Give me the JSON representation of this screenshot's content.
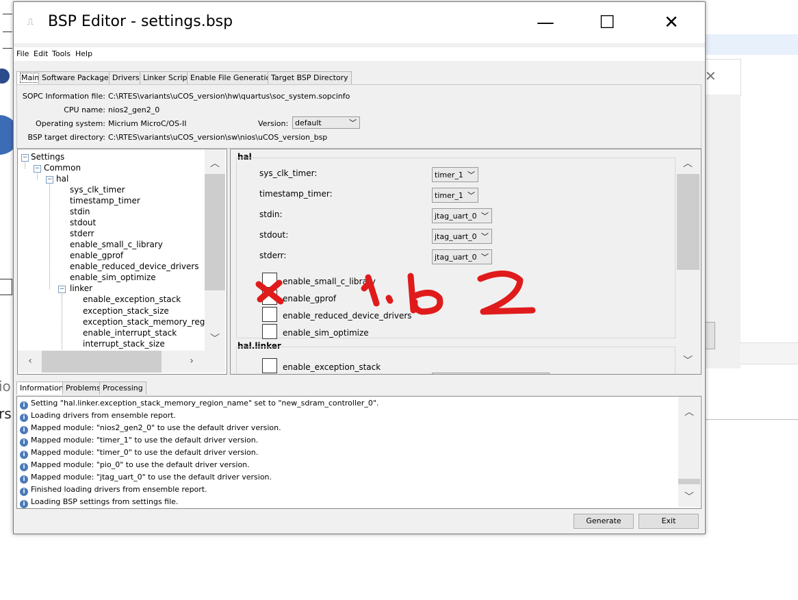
{
  "window": {
    "title": "BSP Editor - settings.bsp",
    "minimize": "—",
    "maximize": "☐",
    "close": "✕"
  },
  "menu": [
    "File",
    "Edit",
    "Tools",
    "Help"
  ],
  "tabs": [
    "Main",
    "Software Packages",
    "Drivers",
    "Linker Script",
    "Enable File Generation",
    "Target BSP Directory"
  ],
  "main": {
    "sopc_label": "SOPC Information file:",
    "sopc_value": "C:\\RTES\\variants\\uCOS_version\\hw\\quartus\\soc_system.sopcinfo",
    "cpu_label": "CPU name:",
    "cpu_value": "nios2_gen2_0",
    "os_label": "Operating system:",
    "os_value": "Micrium MicroC/OS-II",
    "version_label": "Version:",
    "version_value": "default",
    "bsp_label": "BSP target directory:",
    "bsp_value": "C:\\RTES\\variants\\uCOS_version\\sw\\nios\\uCOS_version_bsp"
  },
  "tree": {
    "settings": "Settings",
    "common": "Common",
    "hal": "hal",
    "hal_items": [
      "sys_clk_timer",
      "timestamp_timer",
      "stdin",
      "stdout",
      "stderr",
      "enable_small_c_library",
      "enable_gprof",
      "enable_reduced_device_drivers",
      "enable_sim_optimize"
    ],
    "linker": "linker",
    "linker_items": [
      "enable_exception_stack",
      "exception_stack_size",
      "exception_stack_memory_region",
      "enable_interrupt_stack",
      "interrupt_stack_size"
    ]
  },
  "props": {
    "hal_group": "hal",
    "sys_clk_timer_label": "sys_clk_timer:",
    "sys_clk_timer_value": "timer_1",
    "timestamp_timer_label": "timestamp_timer:",
    "timestamp_timer_value": "timer_1",
    "stdin_label": "stdin:",
    "stdin_value": "jtag_uart_0",
    "stdout_label": "stdout:",
    "stdout_value": "jtag_uart_0",
    "stderr_label": "stderr:",
    "stderr_value": "jtag_uart_0",
    "checkboxes": [
      "enable_small_c_library",
      "enable_gprof",
      "enable_reduced_device_drivers",
      "enable_sim_optimize"
    ],
    "linker_group": "hal.linker",
    "linker_checkbox": "enable_exception_stack"
  },
  "bottom_tabs": [
    "Information",
    "Problems",
    "Processing"
  ],
  "log": [
    "Setting \"hal.linker.exception_stack_memory_region_name\" set to \"new_sdram_controller_0\".",
    "Loading drivers from ensemble report.",
    "Mapped module: \"nios2_gen2_0\" to use the default driver version.",
    "Mapped module: \"timer_1\" to use the default driver version.",
    "Mapped module: \"timer_0\" to use the default driver version.",
    "Mapped module: \"pio_0\" to use the default driver version.",
    "Mapped module: \"jtag_uart_0\" to use the default driver version.",
    "Finished loading drivers from ensemble report.",
    "Loading BSP settings from settings file."
  ],
  "buttons": {
    "generate": "Generate",
    "exit": "Exit"
  },
  "annotation": {
    "color": "#e01b1b"
  },
  "background": {
    "text_io": "io",
    "text_rs": "rs"
  }
}
